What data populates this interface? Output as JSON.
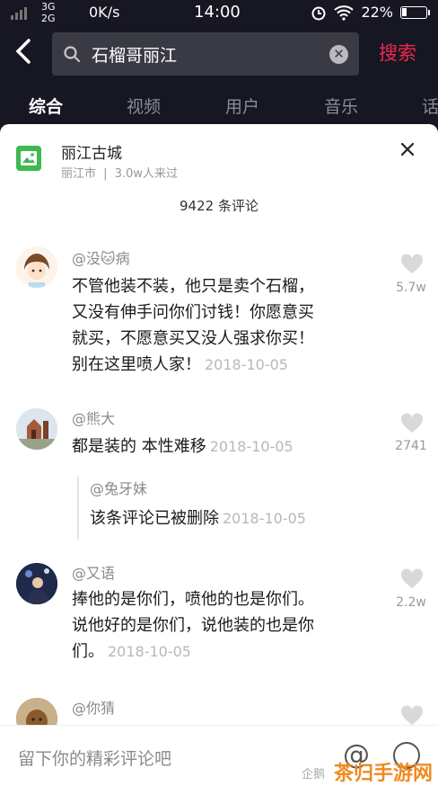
{
  "status": {
    "network_top": "3G",
    "network_bottom": "2G",
    "speed": "0K/s",
    "time": "14:00",
    "battery": "22%"
  },
  "search": {
    "query": "石榴哥丽江",
    "button": "搜索"
  },
  "tabs": [
    "综合",
    "视频",
    "用户",
    "音乐",
    "话"
  ],
  "sheet": {
    "place_name": "丽江古城",
    "place_city": "丽江市",
    "place_visits": "3.0w人来过",
    "comment_count": "9422 条评论"
  },
  "comments": [
    {
      "user": "@没🐱病",
      "lines": [
        "不管他装不装，他只是卖个石榴，",
        "又没有伸手问你们讨钱！你愿意买",
        "就买，不愿意买又没人强求你买！",
        "别在这里喷人家！"
      ],
      "date": "2018-10-05",
      "likes": "5.7w"
    },
    {
      "user": "@熊大",
      "lines": [
        "都是装的 本性难移"
      ],
      "date": "2018-10-05",
      "likes": "2741",
      "reply": {
        "user": "@兔牙妹",
        "text": "该条评论已被删除",
        "date": "2018-10-05"
      }
    },
    {
      "user": "@又语",
      "lines": [
        "捧他的是你们，喷他的也是你们。",
        "说他好的是你们，说他装的也是你",
        "们。"
      ],
      "date": "2018-10-05",
      "likes": "2.2w"
    },
    {
      "user": "@你猜",
      "lines": [],
      "date": "",
      "likes": ""
    }
  ],
  "input": {
    "placeholder": "留下你的精彩评论吧"
  },
  "watermark": {
    "left": "企鹅",
    "right": "茶归手游网"
  },
  "colors": {
    "accent": "#f0284f",
    "header_bg": "#161722",
    "sheet_bg": "#ffffff",
    "place_icon": "#3fb950"
  }
}
